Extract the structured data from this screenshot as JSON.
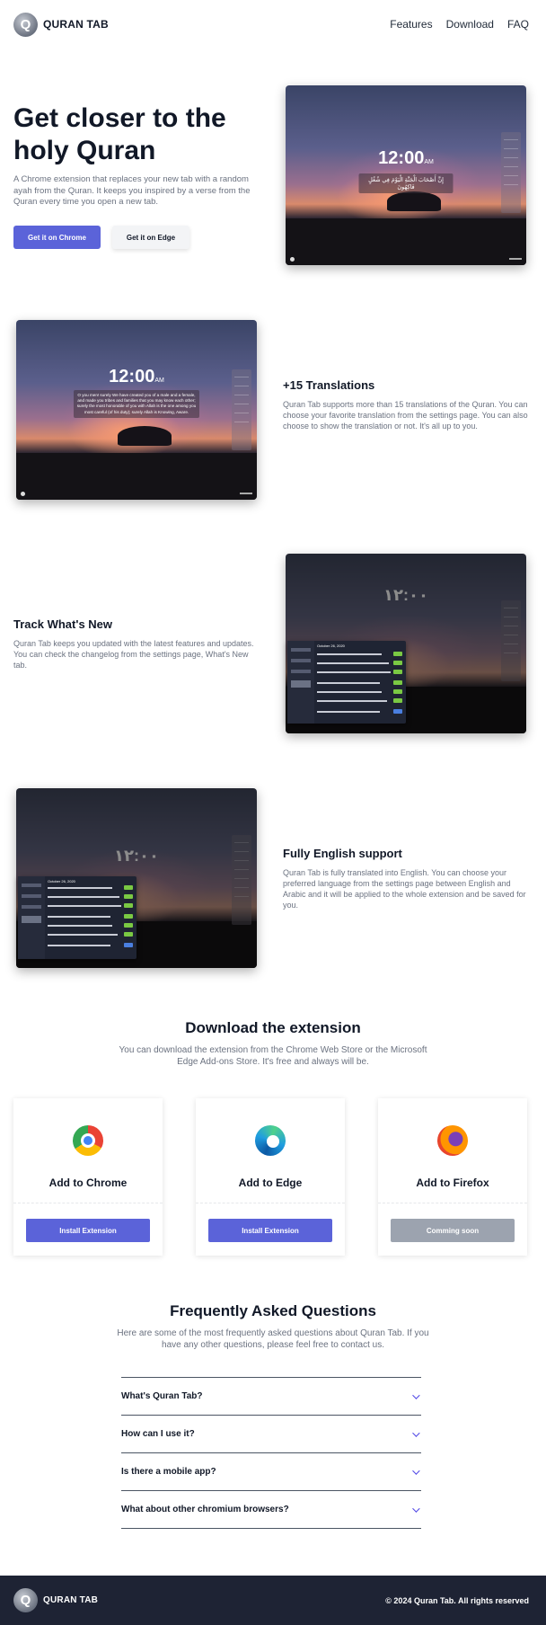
{
  "nav": {
    "brand": "QURAN TAB",
    "links": [
      "Features",
      "Download",
      "FAQ"
    ]
  },
  "hero": {
    "title": "Get closer to the holy Quran",
    "description": "A Chrome extension that replaces your new tab with a random ayah from the Quran. It keeps you inspired by a verse from the Quran every time you open a new tab.",
    "chrome_button": "Get it on Chrome",
    "edge_button": "Get it on Edge",
    "screenshot_time": "12:00",
    "screenshot_ampm": "AM",
    "screenshot_verse": "إِنَّ أَصْحَابَ الْجَنَّةِ الْيَوْمَ فِي شُغُلٍ فَاكِهُونَ"
  },
  "features": [
    {
      "title": "+15 Translations",
      "description": "Quran Tab supports more than 15 translations of the Quran. You can choose your favorite translation from the settings page. You can also choose to show the translation or not. It's all up to you.",
      "screenshot_time": "12:00",
      "screenshot_ampm": "AM",
      "screenshot_verse": "O you men! surely We have created you of a male and a female, and made you tribes and families that you may know each other; surely the most honorable of you with Allah is the one among you most careful (of his duty); surely Allah is Knowing, Aware."
    },
    {
      "title": "Track What's New",
      "description": "Quran Tab keeps you updated with the latest features and updates. You can check the changelog from the settings page, What's New tab.",
      "screenshot_time": "١٢:٠٠",
      "panel_date": "October 26, 2020"
    },
    {
      "title": "Fully English support",
      "description": "Quran Tab is fully translated into English. You can choose your preferred language from the settings page between English and Arabic and it will be applied to the whole extension and be saved for you.",
      "screenshot_time": "١٢:٠٠",
      "panel_date": "October 26, 2020"
    }
  ],
  "download": {
    "title": "Download the extension",
    "description": "You can download the extension from the Chrome Web Store or the Microsoft Edge Add-ons Store. It's free and always will be.",
    "cards": [
      {
        "name": "Add to Chrome",
        "button": "Install Extension",
        "icon": "chrome-icon",
        "button_color": "#5b63d9"
      },
      {
        "name": "Add to Edge",
        "button": "Install Extension",
        "icon": "edge-icon",
        "button_color": "#5b63d9"
      },
      {
        "name": "Add to Firefox",
        "button": "Comming soon",
        "icon": "firefox-icon",
        "button_color": "#9ca3af"
      }
    ]
  },
  "faq": {
    "title": "Frequently Asked Questions",
    "description": "Here are some of the most frequently asked questions about Quran Tab. If you have any other questions, please feel free to contact us.",
    "items": [
      "What's Quran Tab?",
      "How can I use it?",
      "Is there a mobile app?",
      "What about other chromium browsers?"
    ]
  },
  "footer": {
    "brand": "QURAN TAB",
    "copyright": "© 2024 Quran Tab. All rights reserved"
  },
  "colors": {
    "primary": "#5b63d9",
    "footer_bg": "#1e2334",
    "muted_text": "#6b7280"
  }
}
